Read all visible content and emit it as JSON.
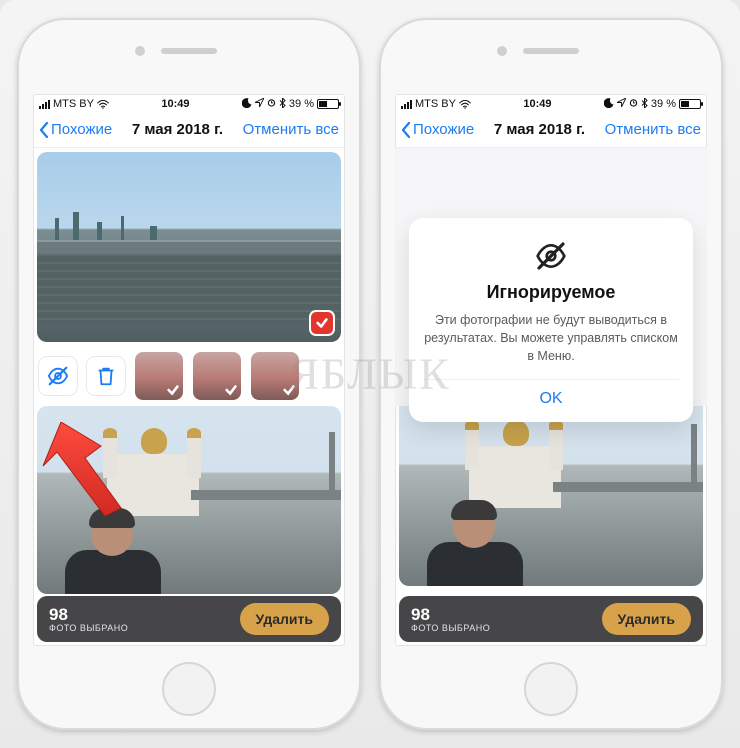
{
  "status": {
    "carrier": "MTS BY",
    "time": "10:49",
    "battery_text": "39 %"
  },
  "nav": {
    "back_label": "Похожие",
    "title": "7 мая 2018 г.",
    "cancel_label": "Отменить все"
  },
  "tools": {
    "hide_icon": "hide-icon",
    "trash_icon": "trash-icon"
  },
  "bottom": {
    "count": "98",
    "count_label": "ФОТО ВЫБРАНО",
    "delete_label": "Удалить"
  },
  "modal": {
    "title": "Игнорируемое",
    "body": "Эти фотографии не будут выводиться в результатах. Вы можете управлять списком в Меню.",
    "ok_label": "OK"
  },
  "watermark": "ЯБЛЫК"
}
